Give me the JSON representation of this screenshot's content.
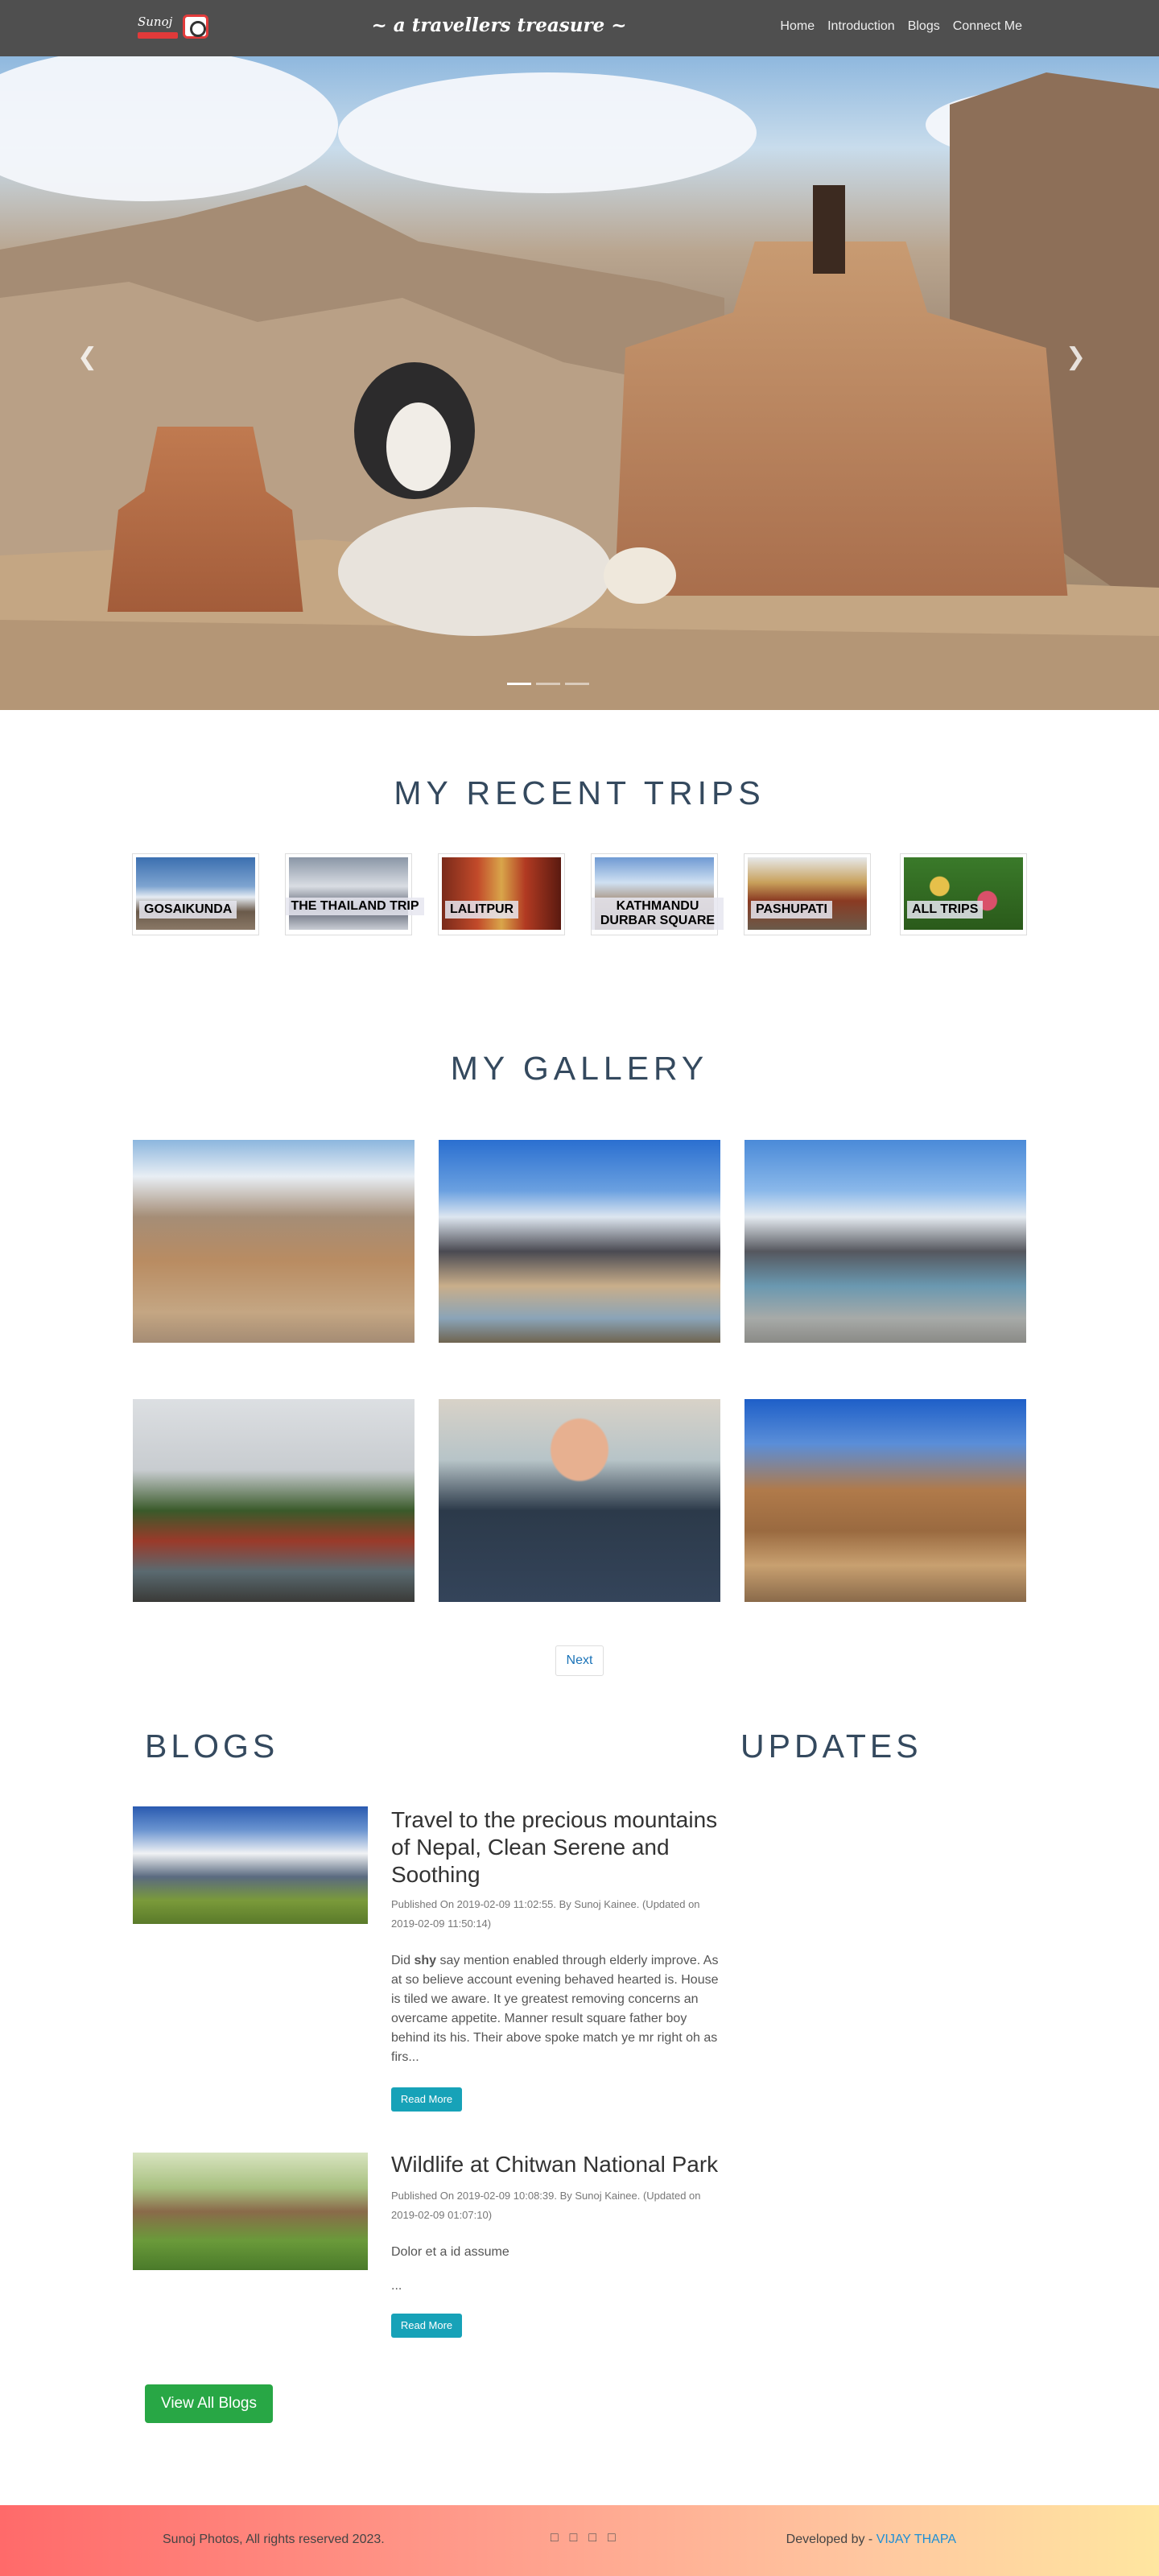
{
  "header": {
    "logo_text": "Sunoj",
    "tagline": "~ a travellers treasure ~",
    "nav": [
      "Home",
      "Introduction",
      "Blogs",
      "Connect Me"
    ]
  },
  "hero": {
    "prev_icon": "chevron-left",
    "next_icon": "chevron-right"
  },
  "recent_trips": {
    "title": "MY RECENT TRIPS",
    "items": [
      "GOSAIKUNDA",
      "THE THAILAND TRIP",
      "LALITPUR",
      "KATHMANDU DURBAR SQUARE",
      "PASHUPATI",
      "ALL TRIPS"
    ]
  },
  "gallery": {
    "title": "MY GALLERY",
    "next_label": "Next"
  },
  "blogs": {
    "title": "BLOGS",
    "posts": [
      {
        "title": "Travel to the precious mountains of Nepal, Clean Serene and Soothing",
        "meta": "Published On 2019-02-09 11:02:55. By Sunoj Kainee. (Updated on 2019-02-09 11:50:14)",
        "excerpt_pre": "Did ",
        "excerpt_bold": "shy",
        "excerpt_post": " say mention enabled through elderly improve. As at so believe account evening behaved hearted is. House is tiled we aware. It ye greatest removing concerns an overcame appetite. Manner result square father boy behind its his. Their above spoke match ye mr right oh as firs...",
        "button": "Read More"
      },
      {
        "title": "Wildlife at Chitwan National Park",
        "meta": "Published On 2019-02-09 10:08:39. By Sunoj Kainee. (Updated on 2019-02-09 01:07:10)",
        "excerpt": "Dolor et a id assume",
        "ellipsis": "...",
        "button": "Read More"
      }
    ],
    "view_all": "View All Blogs"
  },
  "updates": {
    "title": "UPDATES"
  },
  "footer": {
    "copyright": "Sunoj Photos, All rights reserved 2023.",
    "developed_by": "Developed by - ",
    "developer": "VIJAY THAPA",
    "social_icons": [
      "facebook-icon",
      "twitter-icon",
      "instagram-icon",
      "youtube-icon"
    ]
  }
}
